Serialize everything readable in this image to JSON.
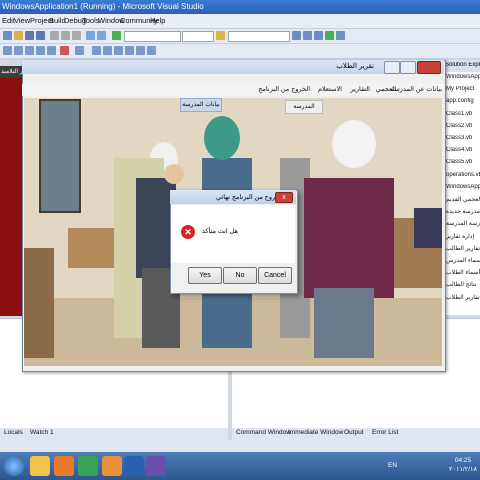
{
  "vs": {
    "title": "WindowsApplication1 (Running) - Microsoft Visual Studio",
    "menu": [
      "Edit",
      "View",
      "Project",
      "Build",
      "Debug",
      "Tools",
      "Window",
      "Community",
      "Help"
    ],
    "left_pane_title": "تقارير التلاميذ"
  },
  "solution_explorer": {
    "title": "Solution Explorer - S...",
    "items": [
      "WindowsApplication",
      "My Project",
      "app.config",
      "Class1.vb",
      "Class2.vb",
      "Class3.vb",
      "Class4.vb",
      "Class5.vb",
      "operations.vb",
      "WindowsApplic",
      "العجمي القديم",
      "إدارة مدرسة جديدة",
      "مدرسة المدرسة",
      "إدارة تقارير",
      "تقارير الطالب",
      "أسماء المدرس",
      "أسماء الطلاب",
      "نتائج الطالب",
      "تقارير الطلاب"
    ]
  },
  "app": {
    "title": "تقرير الطلاب",
    "menu": [
      "بيانات عن المدرسة",
      "العجمي",
      "التقارير",
      "الاستعلام",
      "الخروج من البرنامج"
    ],
    "label_box": "بيانات المدرسة",
    "label_box2": "المدرسة"
  },
  "dialog": {
    "title": "الخروج من البرنامج نهائي",
    "message": "هل انت متأكد",
    "buttons": {
      "yes": "Yes",
      "no": "No",
      "cancel": "Cancel"
    },
    "close": "x"
  },
  "bottom_tabs_left": [
    "Locals",
    "Watch 1"
  ],
  "bottom_tabs_right": [
    "Command Window",
    "Immediate Window",
    "Output",
    "Error List"
  ],
  "taskbar": {
    "lang": "EN",
    "time": "04:25",
    "date": "٢٠١١/٢/١٨"
  }
}
